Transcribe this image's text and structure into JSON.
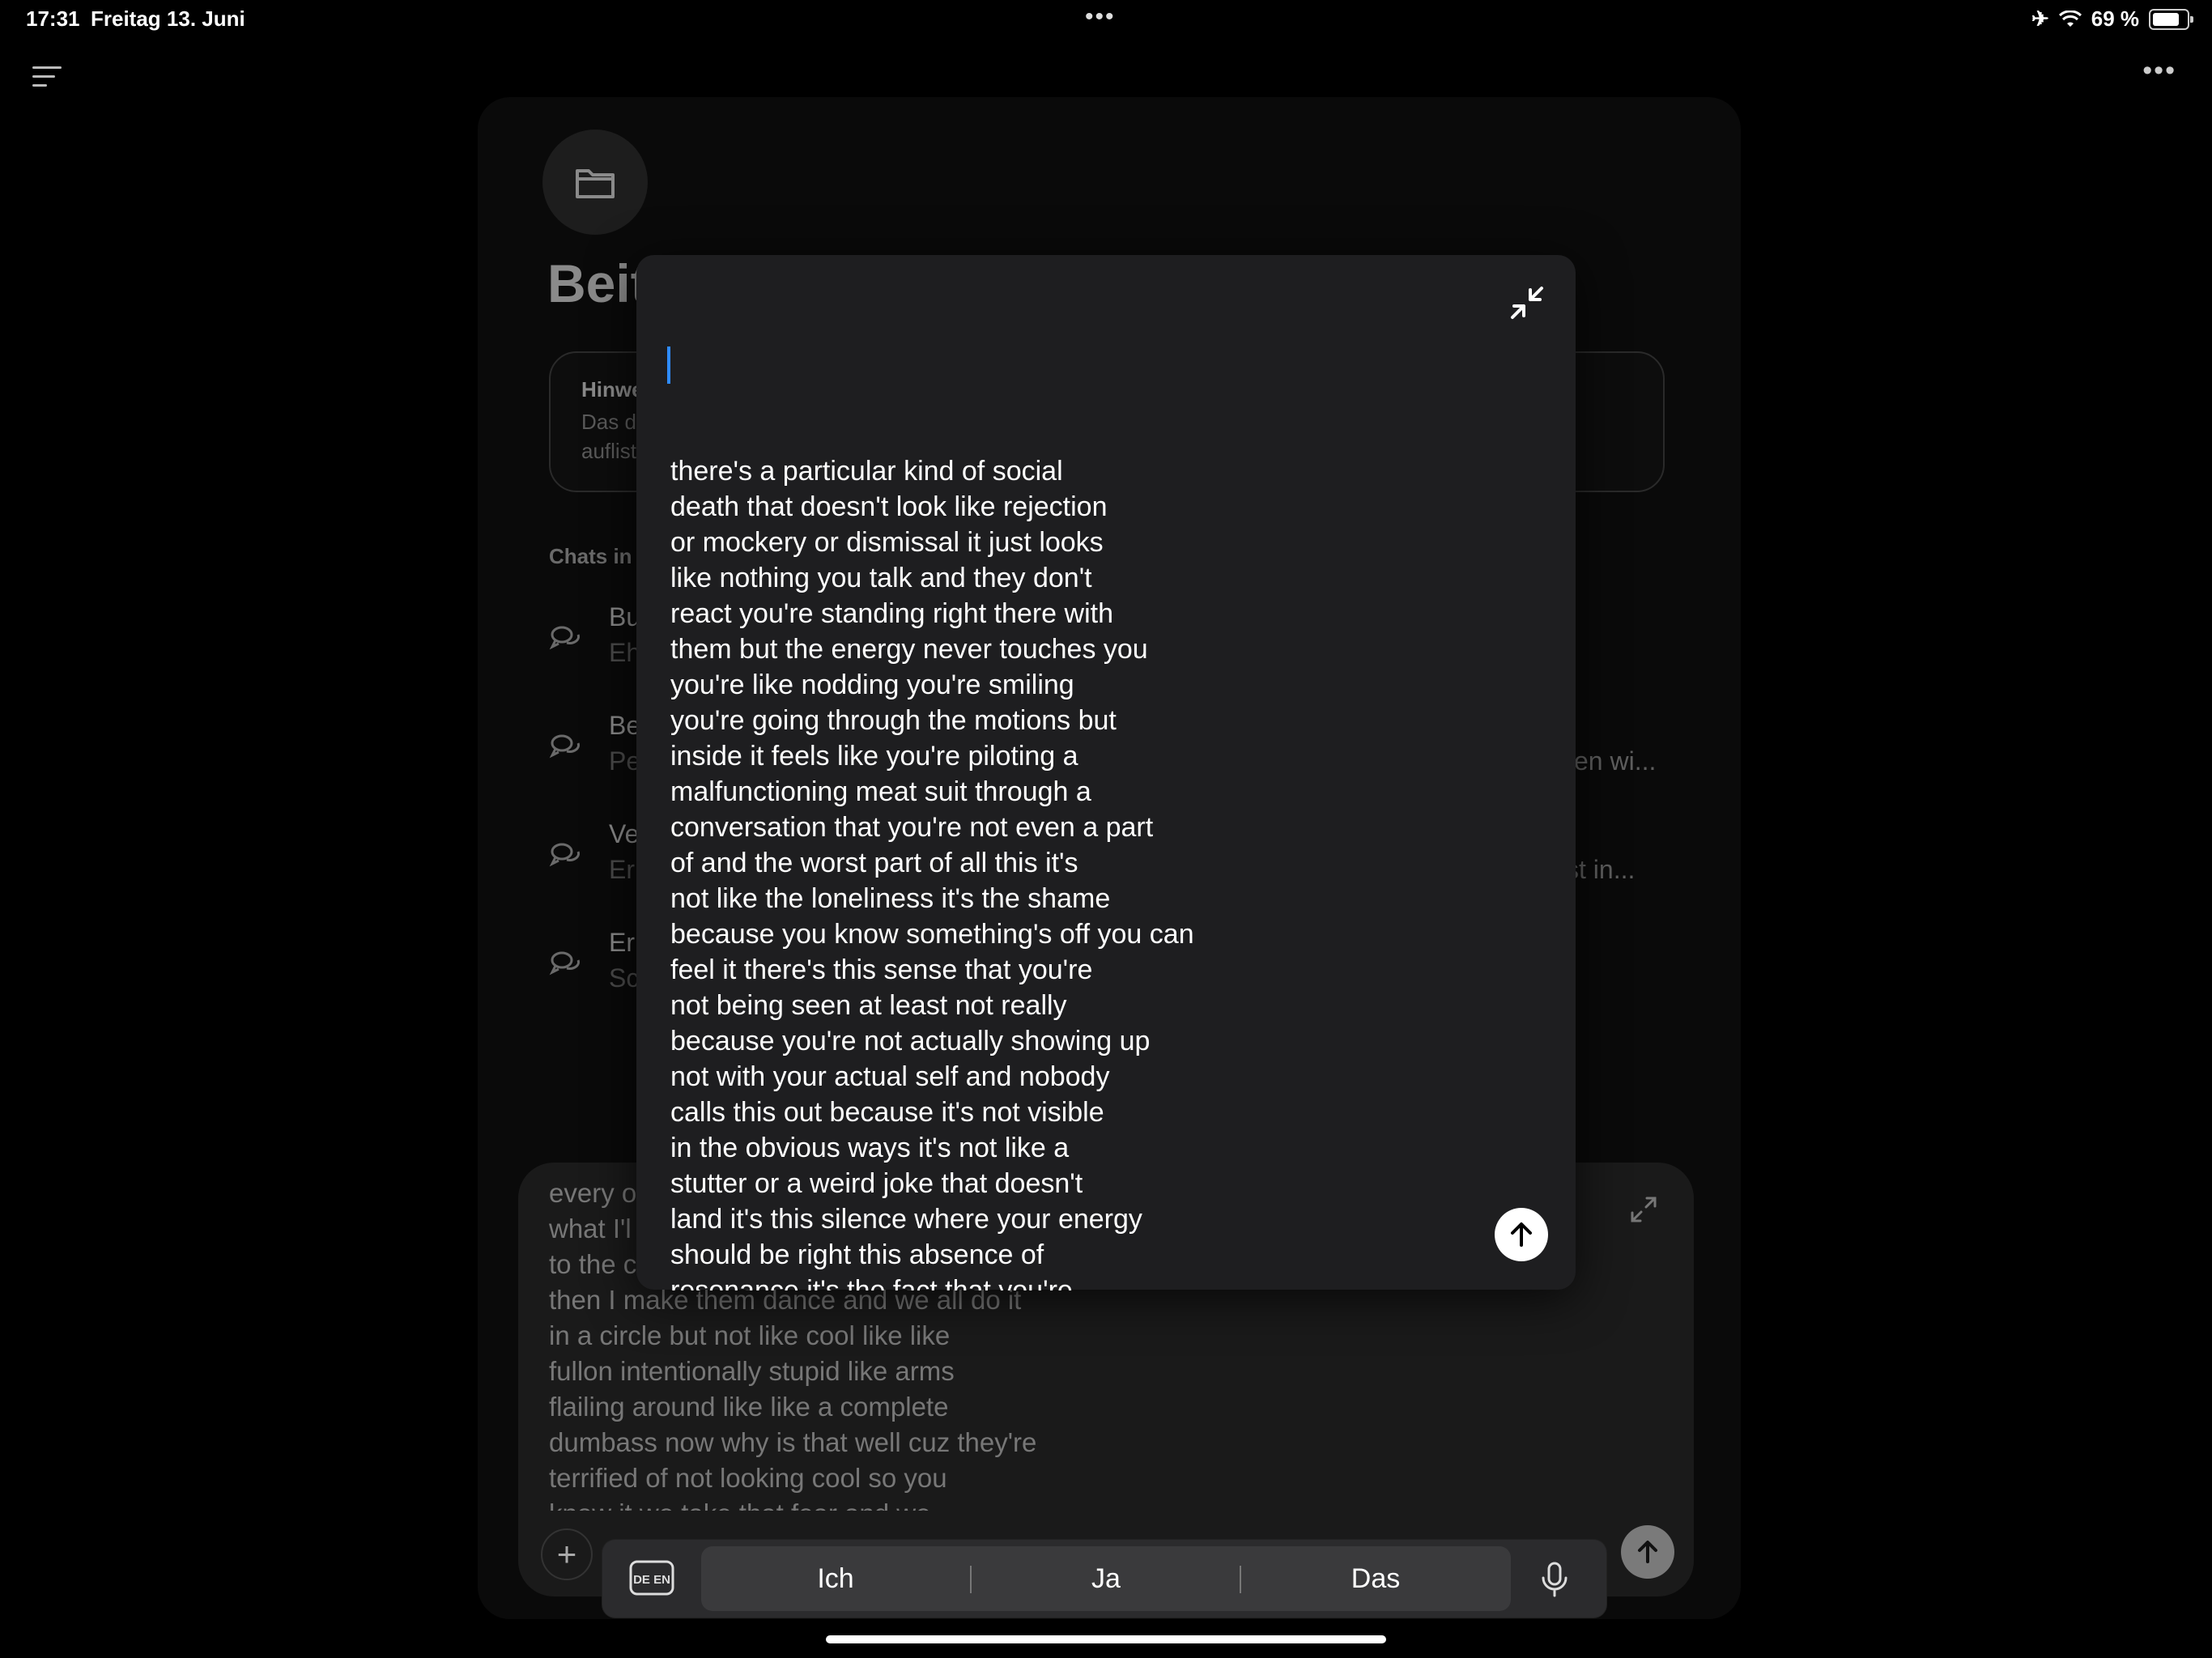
{
  "status_bar": {
    "time": "17:31",
    "date": "Freitag 13. Juni",
    "battery_percent": "69 %",
    "battery_level": 0.69
  },
  "background_page": {
    "title_partial": "Beit",
    "hint_title_partial": "Hinwe",
    "hint_lines_partial": [
      "Das d",
      "auflist"
    ],
    "chats_label_partial": "Chats in",
    "chats": [
      {
        "title_partial": "Bu",
        "subtitle_partial": "Eh",
        "right_partial": ""
      },
      {
        "title_partial": "Be",
        "subtitle_partial": "Pe",
        "right_partial": "en wi..."
      },
      {
        "title_partial": "Ve",
        "subtitle_partial": "Er",
        "right_partial": "st in..."
      },
      {
        "title_partial": "Er",
        "subtitle_partial": "Sc",
        "right_partial": ""
      }
    ]
  },
  "composer": {
    "visible_text": "every o\nwhat I'l\nto the c\nthen I make them dance and we all do it\nin a circle but not like cool like like\nfullon intentionally stupid like arms\nflailing around like like a complete\ndumbass now why is that well cuz they're\nterrified of not looking cool so you\nknow it we take that fear and we"
  },
  "modal": {
    "text": "there's a particular kind of social\ndeath that doesn't look like rejection\nor mockery or dismissal it just looks\nlike nothing you talk and they don't\nreact you're standing right there with\nthem but the energy never touches you\nyou're like nodding you're smiling\nyou're going through the motions but\ninside it feels like you're piloting a\nmalfunctioning meat suit through a\nconversation that you're not even a part\nof and the worst part of all this it's\nnot like the loneliness it's the shame\nbecause you know something's off you can\nfeel it there's this sense that you're\nnot being seen at least not really\nbecause you're not actually showing up\nnot with your actual self and nobody\ncalls this out because it's not visible\nin the obvious ways it's not like a\nstutter or a weird joke that doesn't\nland it's this silence where your energy\nshould be right this absence of\nresonance it's the fact that you're"
  },
  "keyboard": {
    "lang_label": "DE EN",
    "suggestions": [
      "Ich",
      "Ja",
      "Das"
    ]
  },
  "icons": {
    "menu": "menu-icon",
    "more": "more-icon",
    "folder": "folder-icon",
    "chat": "chat-bubbles-icon",
    "collapse": "collapse-icon",
    "expand": "expand-icon",
    "send": "arrow-up-icon",
    "mic": "mic-icon",
    "plus": "plus-icon",
    "airplane": "airplane-icon",
    "wifi": "wifi-icon"
  }
}
